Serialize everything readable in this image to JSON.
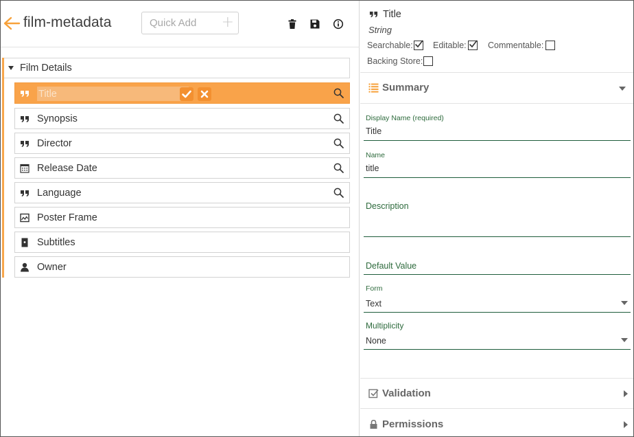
{
  "app": {
    "title": "film-metadata",
    "quick_add_placeholder": "Quick Add"
  },
  "toolbar": {
    "icons": [
      "delete-icon",
      "save-icon",
      "info-icon"
    ]
  },
  "group": {
    "label": "Film Details",
    "fields": [
      {
        "label": "Title",
        "icon": "quote-icon",
        "searchable": true,
        "selected": true
      },
      {
        "label": "Synopsis",
        "icon": "quote-icon",
        "searchable": true
      },
      {
        "label": "Director",
        "icon": "quote-icon",
        "searchable": true
      },
      {
        "label": "Release Date",
        "icon": "calendar-icon",
        "searchable": true
      },
      {
        "label": "Language",
        "icon": "quote-icon",
        "searchable": true
      },
      {
        "label": "Poster Frame",
        "icon": "image-icon",
        "searchable": false
      },
      {
        "label": "Subtitles",
        "icon": "file-icon",
        "searchable": false
      },
      {
        "label": "Owner",
        "icon": "user-icon",
        "searchable": false
      }
    ]
  },
  "properties": {
    "title": "Title",
    "type": "String",
    "flags": {
      "searchable": {
        "label": "Searchable:",
        "checked": true
      },
      "editable": {
        "label": "Editable:",
        "checked": true
      },
      "commentable": {
        "label": "Commentable:",
        "checked": false
      },
      "backing_store": {
        "label": "Backing Store:",
        "checked": false
      }
    },
    "summary": {
      "title": "Summary",
      "display_name": {
        "label": "Display Name (required)",
        "value": "Title"
      },
      "name": {
        "label": "Name",
        "value": "title"
      },
      "description": {
        "label": "Description",
        "value": ""
      },
      "default_value": {
        "label": "Default Value",
        "value": ""
      },
      "form": {
        "label": "Form",
        "value": "Text"
      },
      "multiplicity": {
        "label": "Multiplicity",
        "value": "None"
      }
    },
    "validation": {
      "title": "Validation"
    },
    "permissions": {
      "title": "Permissions"
    }
  },
  "colors": {
    "accent": "#f9a34a",
    "accent_dark": "#f39030",
    "field_line": "#1d5c3a",
    "field_label": "#2d6a3c"
  }
}
